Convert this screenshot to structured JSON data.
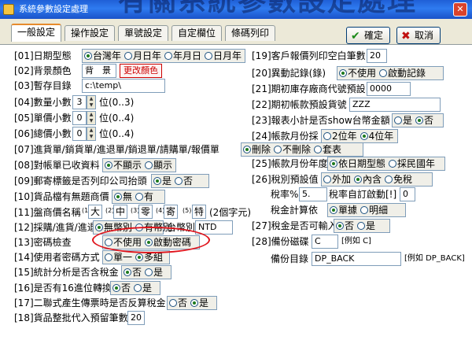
{
  "window": {
    "title": "系統參數設定處理",
    "banner_text": "有關系統參數設定處理"
  },
  "tabs": [
    {
      "label": "一般設定"
    },
    {
      "label": "操作設定"
    },
    {
      "label": "單號設定"
    },
    {
      "label": "自定欄位"
    },
    {
      "label": "條碼列印"
    }
  ],
  "actions": {
    "confirm": "確定",
    "cancel": "取消"
  },
  "left": {
    "f01": {
      "label": "[01]日期型態",
      "options": [
        "台灣年",
        "月日年",
        "年月日",
        "日月年"
      ]
    },
    "f02": {
      "label": "[02]背景顏色",
      "value": "背　景",
      "button": "更改顏色"
    },
    "f03": {
      "label": "[03]暫存目錄",
      "value": "c:\\temp\\"
    },
    "f04": {
      "label": "[04]數量小數",
      "value": "3",
      "note": "位(0..3)"
    },
    "f05": {
      "label": "[05]單價小數",
      "value": "0",
      "note": "位(0..4)"
    },
    "f06": {
      "label": "[06]總價小數",
      "value": "0",
      "note": "位(0..4)"
    },
    "f07": {
      "label": "[07]進貨單/銷貨單/進退單/銷退單/請購單/報價單",
      "options": [
        "刪除",
        "不刪除",
        "套表"
      ]
    },
    "f08": {
      "label": "[08]對帳單已收資料",
      "options": [
        "不顯示",
        "顯示"
      ]
    },
    "f09": {
      "label": "[09]郵寄標籤是否列印公司抬頭",
      "options": [
        "是",
        "否"
      ]
    },
    "f10": {
      "label": "[10]貨品檔有無題商價",
      "options": [
        "無",
        "有"
      ]
    },
    "f11": {
      "label": "[11]盤商價名稱",
      "cells": [
        "(1)",
        "大",
        "(2)",
        "中",
        "(3)",
        "零",
        "(4)",
        "寄",
        "(5)",
        "特"
      ],
      "note": "(2個字元)"
    },
    "f12": {
      "label": "[12]採購/進貨/進退",
      "options": [
        "無幣別",
        "有幣別"
      ],
      "currency_label": "台幣別",
      "currency_value": "NTD"
    },
    "f13": {
      "label": "[13]密碼檢查",
      "options": [
        "不使用",
        "啟動密碼"
      ]
    },
    "f14": {
      "label": "[14]使用者密碼方式",
      "options": [
        "單一",
        "多組"
      ]
    },
    "f15": {
      "label": "[15]統計分析是否含稅金",
      "options": [
        "否",
        "是"
      ]
    },
    "f16": {
      "label": "[16]是否有16進位轉換",
      "options": [
        "否",
        "是"
      ]
    },
    "f17": {
      "label": "[17]二聯式產生傳票時是否反算稅金",
      "options": [
        "否",
        "是"
      ]
    },
    "f18": {
      "label": "[18]貨品整批代入預留筆數",
      "value": "20"
    }
  },
  "right": {
    "f19": {
      "label": "[19]客戶報價列印空白筆數",
      "value": "20"
    },
    "f20": {
      "label": "[20]異動記錄(錄)",
      "options": [
        "不使用",
        "啟動記錄"
      ]
    },
    "f21": {
      "label": "[21]期初庫存廠商代號預設",
      "value": "0000"
    },
    "f22": {
      "label": "[22]期初帳款預設貨號",
      "value": "ZZZ"
    },
    "f23": {
      "label": "[23]報表小計是否show台幣金額",
      "options": [
        "是",
        "否"
      ]
    },
    "f24": {
      "label": "[24]帳款月份採",
      "options": [
        "2位年",
        "4位年"
      ]
    },
    "f25": {
      "label": "[25]帳款月份年度",
      "options": [
        "依日期型態",
        "採民國年"
      ]
    },
    "f26": {
      "label": "[26]稅別預設值",
      "options": [
        "外加",
        "內含",
        "免稅"
      ],
      "tax_rate_label": "稅率%",
      "tax_rate_value": "5.",
      "auto_label": "稅率自訂啟動[!]",
      "auto_value": "0",
      "calc_label": "稅金計算依",
      "calc_options": [
        "單據",
        "明細"
      ]
    },
    "f27": {
      "label": "[27]稅金是否可輸入",
      "options": [
        "否",
        "是"
      ]
    },
    "f28": {
      "label": "[28]備份磁碟",
      "value": "C",
      "note": "[例如 C]",
      "dir_label": "備份目錄",
      "dir_value": "DP_BACK",
      "dir_note": "[例如 DP_BACK]"
    }
  }
}
